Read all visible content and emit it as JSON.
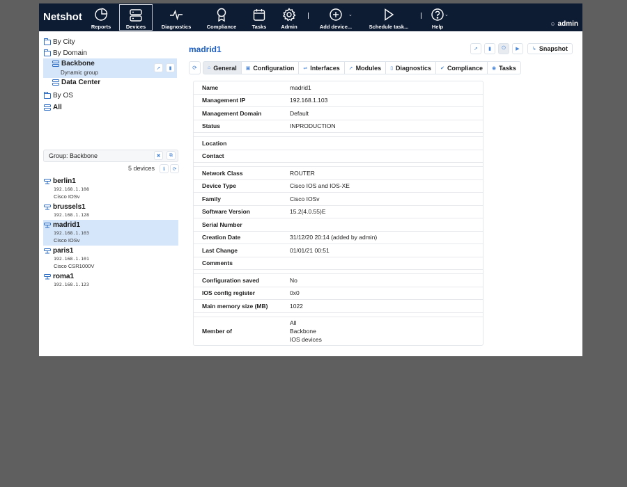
{
  "app": {
    "brand": "Netshot",
    "nav": [
      {
        "label": "Reports",
        "icon": "pie-chart-icon"
      },
      {
        "label": "Devices",
        "icon": "server-icon",
        "active": true
      },
      {
        "label": "Diagnostics",
        "icon": "pulse-icon"
      },
      {
        "label": "Compliance",
        "icon": "award-icon"
      },
      {
        "label": "Tasks",
        "icon": "calendar-icon"
      },
      {
        "label": "Admin",
        "icon": "gear-icon"
      },
      {
        "label": "Add device...",
        "icon": "plus-circle-icon"
      },
      {
        "label": "Schedule task...",
        "icon": "play-icon"
      },
      {
        "label": "Help",
        "icon": "help-circle-icon"
      }
    ],
    "user": "admin"
  },
  "groups_tree": {
    "items": [
      {
        "label": "By City",
        "type": "folder"
      },
      {
        "label": "By Domain",
        "type": "folder"
      },
      {
        "label": "Backbone",
        "type": "group",
        "subtitle": "Dynamic group",
        "selected": true
      },
      {
        "label": "Data Center",
        "type": "group"
      },
      {
        "label": "By OS",
        "type": "folder"
      },
      {
        "label": "All",
        "type": "group"
      }
    ]
  },
  "device_list": {
    "filter_label": "Group: Backbone",
    "count_label": "5 devices",
    "devices": [
      {
        "name": "berlin1",
        "ip": "192.168.1.108",
        "family": "Cisco IOSv"
      },
      {
        "name": "brussels1",
        "ip": "192.168.1.128",
        "family": ""
      },
      {
        "name": "madrid1",
        "ip": "192.168.1.103",
        "family": "Cisco IOSv",
        "selected": true
      },
      {
        "name": "paris1",
        "ip": "192.168.1.101",
        "family": "Cisco CSR1000V"
      },
      {
        "name": "roma1",
        "ip": "192.168.1.123",
        "family": ""
      }
    ]
  },
  "device": {
    "title": "madrid1",
    "snapshot_label": "Snapshot",
    "tabs": [
      {
        "label": "General",
        "active": true
      },
      {
        "label": "Configuration"
      },
      {
        "label": "Interfaces"
      },
      {
        "label": "Modules"
      },
      {
        "label": "Diagnostics"
      },
      {
        "label": "Compliance"
      },
      {
        "label": "Tasks"
      }
    ],
    "properties": [
      {
        "key": "Name",
        "value": "madrid1"
      },
      {
        "key": "Management IP",
        "value": "192.168.1.103"
      },
      {
        "key": "Management Domain",
        "value": "Default"
      },
      {
        "key": "Status",
        "value": "INPRODUCTION"
      },
      {
        "key": "Location",
        "value": ""
      },
      {
        "key": "Contact",
        "value": ""
      },
      {
        "key": "Network Class",
        "value": "ROUTER"
      },
      {
        "key": "Device Type",
        "value": "Cisco IOS and IOS-XE"
      },
      {
        "key": "Family",
        "value": "Cisco IOSv"
      },
      {
        "key": "Software Version",
        "value": "15.2(4.0.55)E"
      },
      {
        "key": "Serial Number",
        "value": ""
      },
      {
        "key": "Creation Date",
        "value": "31/12/20 20:14 (added by admin)"
      },
      {
        "key": "Last Change",
        "value": "01/01/21 00:51"
      },
      {
        "key": "Comments",
        "value": ""
      },
      {
        "key": "Configuration saved",
        "value": "No"
      },
      {
        "key": "IOS config register",
        "value": "0x0"
      },
      {
        "key": "Main memory size (MB)",
        "value": "1022"
      },
      {
        "key": "Member of",
        "value": [
          "All",
          "Backbone",
          "IOS devices"
        ]
      }
    ]
  },
  "colors": {
    "topbar": "#0d1b33",
    "accent": "#1d5fc2",
    "selection": "#d6e6fa"
  }
}
